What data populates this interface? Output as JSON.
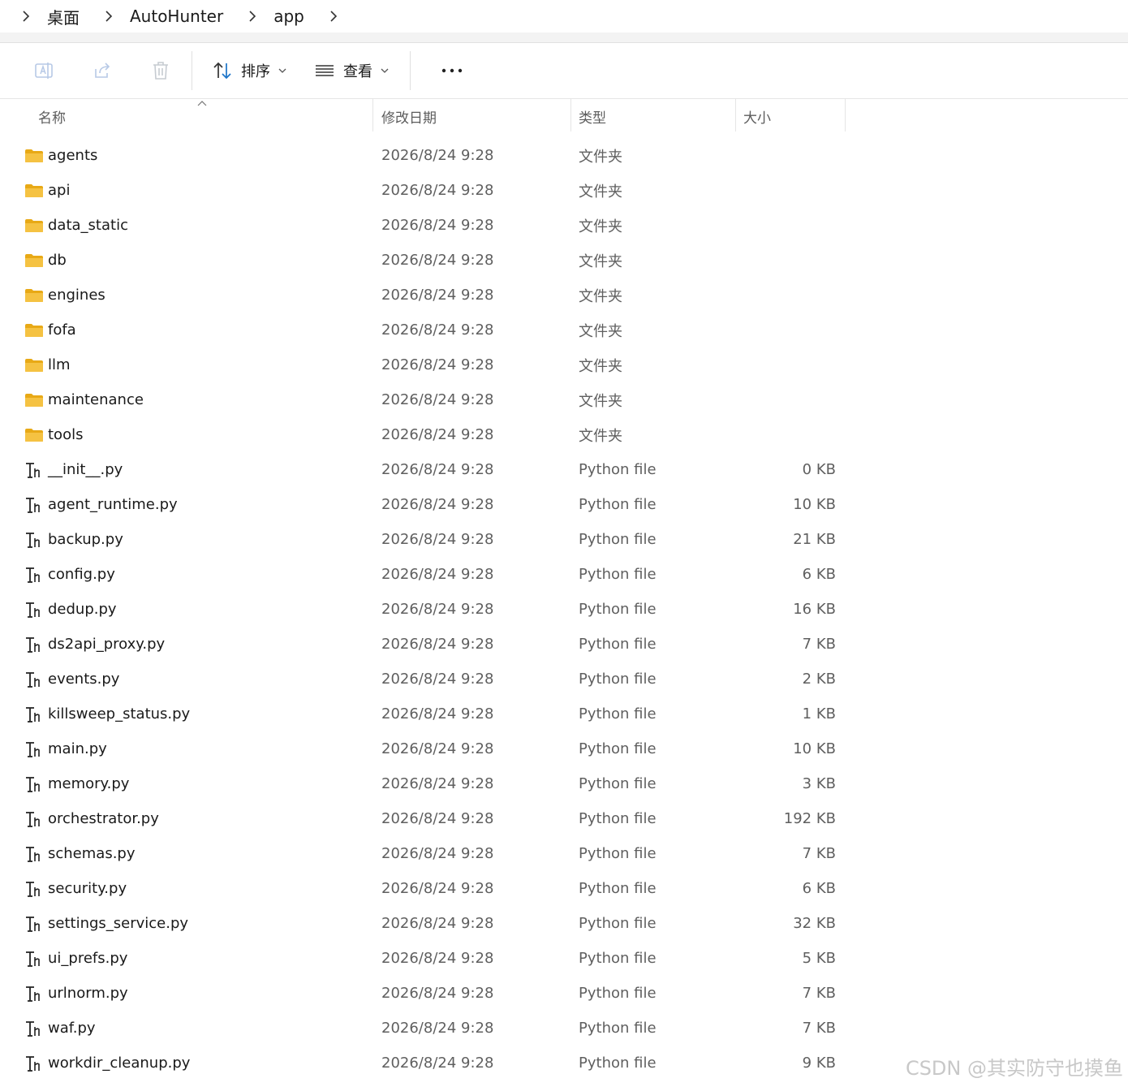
{
  "breadcrumb": {
    "items": [
      "桌面",
      "AutoHunter",
      "app"
    ]
  },
  "toolbar": {
    "sort_label": "排序",
    "view_label": "查看",
    "icons": [
      "rename-icon",
      "share-icon",
      "delete-icon",
      "sort-icon",
      "view-icon",
      "more-icon"
    ]
  },
  "columns": {
    "name": "名称",
    "date": "修改日期",
    "type": "类型",
    "size": "大小"
  },
  "files": [
    {
      "name": "agents",
      "date": "2026/8/24 9:28",
      "type": "文件夹",
      "size": "",
      "kind": "folder"
    },
    {
      "name": "api",
      "date": "2026/8/24 9:28",
      "type": "文件夹",
      "size": "",
      "kind": "folder"
    },
    {
      "name": "data_static",
      "date": "2026/8/24 9:28",
      "type": "文件夹",
      "size": "",
      "kind": "folder"
    },
    {
      "name": "db",
      "date": "2026/8/24 9:28",
      "type": "文件夹",
      "size": "",
      "kind": "folder"
    },
    {
      "name": "engines",
      "date": "2026/8/24 9:28",
      "type": "文件夹",
      "size": "",
      "kind": "folder"
    },
    {
      "name": "fofa",
      "date": "2026/8/24 9:28",
      "type": "文件夹",
      "size": "",
      "kind": "folder"
    },
    {
      "name": "llm",
      "date": "2026/8/24 9:28",
      "type": "文件夹",
      "size": "",
      "kind": "folder"
    },
    {
      "name": "maintenance",
      "date": "2026/8/24 9:28",
      "type": "文件夹",
      "size": "",
      "kind": "folder"
    },
    {
      "name": "tools",
      "date": "2026/8/24 9:28",
      "type": "文件夹",
      "size": "",
      "kind": "folder"
    },
    {
      "name": "__init__.py",
      "date": "2026/8/24 9:28",
      "type": "Python file",
      "size": "0 KB",
      "kind": "file"
    },
    {
      "name": "agent_runtime.py",
      "date": "2026/8/24 9:28",
      "type": "Python file",
      "size": "10 KB",
      "kind": "file"
    },
    {
      "name": "backup.py",
      "date": "2026/8/24 9:28",
      "type": "Python file",
      "size": "21 KB",
      "kind": "file"
    },
    {
      "name": "config.py",
      "date": "2026/8/24 9:28",
      "type": "Python file",
      "size": "6 KB",
      "kind": "file"
    },
    {
      "name": "dedup.py",
      "date": "2026/8/24 9:28",
      "type": "Python file",
      "size": "16 KB",
      "kind": "file"
    },
    {
      "name": "ds2api_proxy.py",
      "date": "2026/8/24 9:28",
      "type": "Python file",
      "size": "7 KB",
      "kind": "file"
    },
    {
      "name": "events.py",
      "date": "2026/8/24 9:28",
      "type": "Python file",
      "size": "2 KB",
      "kind": "file"
    },
    {
      "name": "killsweep_status.py",
      "date": "2026/8/24 9:28",
      "type": "Python file",
      "size": "1 KB",
      "kind": "file"
    },
    {
      "name": "main.py",
      "date": "2026/8/24 9:28",
      "type": "Python file",
      "size": "10 KB",
      "kind": "file"
    },
    {
      "name": "memory.py",
      "date": "2026/8/24 9:28",
      "type": "Python file",
      "size": "3 KB",
      "kind": "file"
    },
    {
      "name": "orchestrator.py",
      "date": "2026/8/24 9:28",
      "type": "Python file",
      "size": "192 KB",
      "kind": "file"
    },
    {
      "name": "schemas.py",
      "date": "2026/8/24 9:28",
      "type": "Python file",
      "size": "7 KB",
      "kind": "file"
    },
    {
      "name": "security.py",
      "date": "2026/8/24 9:28",
      "type": "Python file",
      "size": "6 KB",
      "kind": "file"
    },
    {
      "name": "settings_service.py",
      "date": "2026/8/24 9:28",
      "type": "Python file",
      "size": "32 KB",
      "kind": "file"
    },
    {
      "name": "ui_prefs.py",
      "date": "2026/8/24 9:28",
      "type": "Python file",
      "size": "5 KB",
      "kind": "file"
    },
    {
      "name": "urlnorm.py",
      "date": "2026/8/24 9:28",
      "type": "Python file",
      "size": "7 KB",
      "kind": "file"
    },
    {
      "name": "waf.py",
      "date": "2026/8/24 9:28",
      "type": "Python file",
      "size": "7 KB",
      "kind": "file"
    },
    {
      "name": "workdir_cleanup.py",
      "date": "2026/8/24 9:28",
      "type": "Python file",
      "size": "9 KB",
      "kind": "file"
    }
  ],
  "watermark": "CSDN @其实防守也摸鱼",
  "colors": {
    "folder": "#f5c242",
    "folder_dark": "#e8a916",
    "text_secondary": "#5f5f5f",
    "accent": "#1a73c8"
  }
}
